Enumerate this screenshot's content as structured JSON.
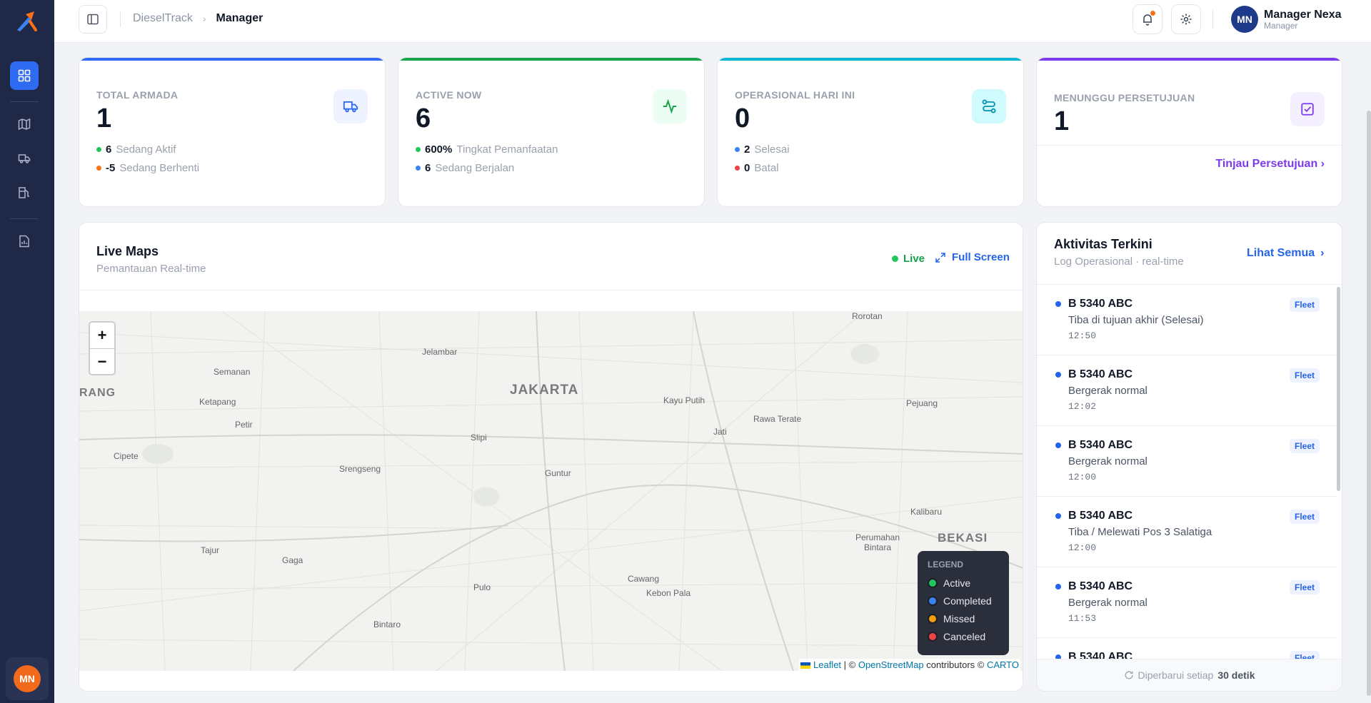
{
  "colors": {
    "sidebar": "#1f2846",
    "accent": "#2f6bf2",
    "armada_bar": "#2f6bf2",
    "active_bar": "#16a34a",
    "ops_bar": "#06b6d4",
    "approval_bar": "#7c3aed"
  },
  "sidebar": {
    "icons": [
      "dashboard-icon",
      "map-icon",
      "truck-icon",
      "fuel-icon",
      "report-icon"
    ],
    "avatar_initials": "MN"
  },
  "header": {
    "breadcrumb": [
      "DieselTrack",
      "Manager"
    ],
    "user": {
      "initials": "MN",
      "name": "Manager Nexa",
      "role": "Manager"
    }
  },
  "stats": {
    "armada": {
      "label": "TOTAL ARMADA",
      "value": "1",
      "line1_n": "6",
      "line1_t": "Sedang Aktif",
      "line2_n": "-5",
      "line2_t": "Sedang Berhenti"
    },
    "active": {
      "label": "ACTIVE NOW",
      "value": "6",
      "line1_n": "600%",
      "line1_t": "Tingkat Pemanfaatan",
      "line2_n": "6",
      "line2_t": "Sedang Berjalan"
    },
    "ops": {
      "label": "OPERASIONAL HARI INI",
      "value": "0",
      "line1_n": "2",
      "line1_t": "Selesai",
      "line2_n": "0",
      "line2_t": "Batal"
    },
    "approval": {
      "label": "MENUNGGU PERSETUJUAN",
      "value": "1",
      "link": "Tinjau Persetujuan ›"
    }
  },
  "map": {
    "title": "Live Maps",
    "subtitle": "Pemantauan Real-time",
    "live": "Live",
    "fullscreen": "Full Screen",
    "zoom_in": "+",
    "zoom_out": "−",
    "places": [
      "Rorotan",
      "Jelambar",
      "Semanan",
      "RANG",
      "JAKARTA",
      "Ketapang",
      "Kayu Putih",
      "Pejuang",
      "Petir",
      "Rawa Terate",
      "Jati",
      "Slipi",
      "Cipete",
      "Srengseng",
      "Guntur",
      "Kalibaru",
      "Perumahan Bintara",
      "BEKASI",
      "Tajur",
      "Gaga",
      "Cawang",
      "Kebon Pala",
      "Pulo",
      "Bintaro"
    ],
    "legend": {
      "title": "LEGEND",
      "items": [
        {
          "label": "Active",
          "color": "#22c55e"
        },
        {
          "label": "Completed",
          "color": "#3b82f6"
        },
        {
          "label": "Missed",
          "color": "#f59e0b"
        },
        {
          "label": "Canceled",
          "color": "#ef4444"
        }
      ]
    },
    "attribution": {
      "leaflet": "Leaflet",
      "sep": " | © ",
      "osm": "OpenStreetMap",
      "contrib": " contributors © ",
      "carto": "CARTO"
    }
  },
  "activity": {
    "title": "Aktivitas Terkini",
    "subtitle": "Log Operasional · real-time",
    "see_all": "Lihat Semua",
    "items": [
      {
        "plate": "B 5340 ABC",
        "desc": "Tiba di tujuan akhir (Selesai)",
        "time": "12:50",
        "badge": "Fleet"
      },
      {
        "plate": "B 5340 ABC",
        "desc": "Bergerak normal",
        "time": "12:02",
        "badge": "Fleet"
      },
      {
        "plate": "B 5340 ABC",
        "desc": "Bergerak normal",
        "time": "12:00",
        "badge": "Fleet"
      },
      {
        "plate": "B 5340 ABC",
        "desc": "Tiba / Melewati Pos 3 Salatiga",
        "time": "12:00",
        "badge": "Fleet"
      },
      {
        "plate": "B 5340 ABC",
        "desc": "Bergerak normal",
        "time": "11:53",
        "badge": "Fleet"
      },
      {
        "plate": "B 5340 ABC",
        "desc": "",
        "time": "",
        "badge": "Fleet"
      }
    ],
    "footer_text": "Diperbarui setiap",
    "footer_value": "30 detik"
  }
}
